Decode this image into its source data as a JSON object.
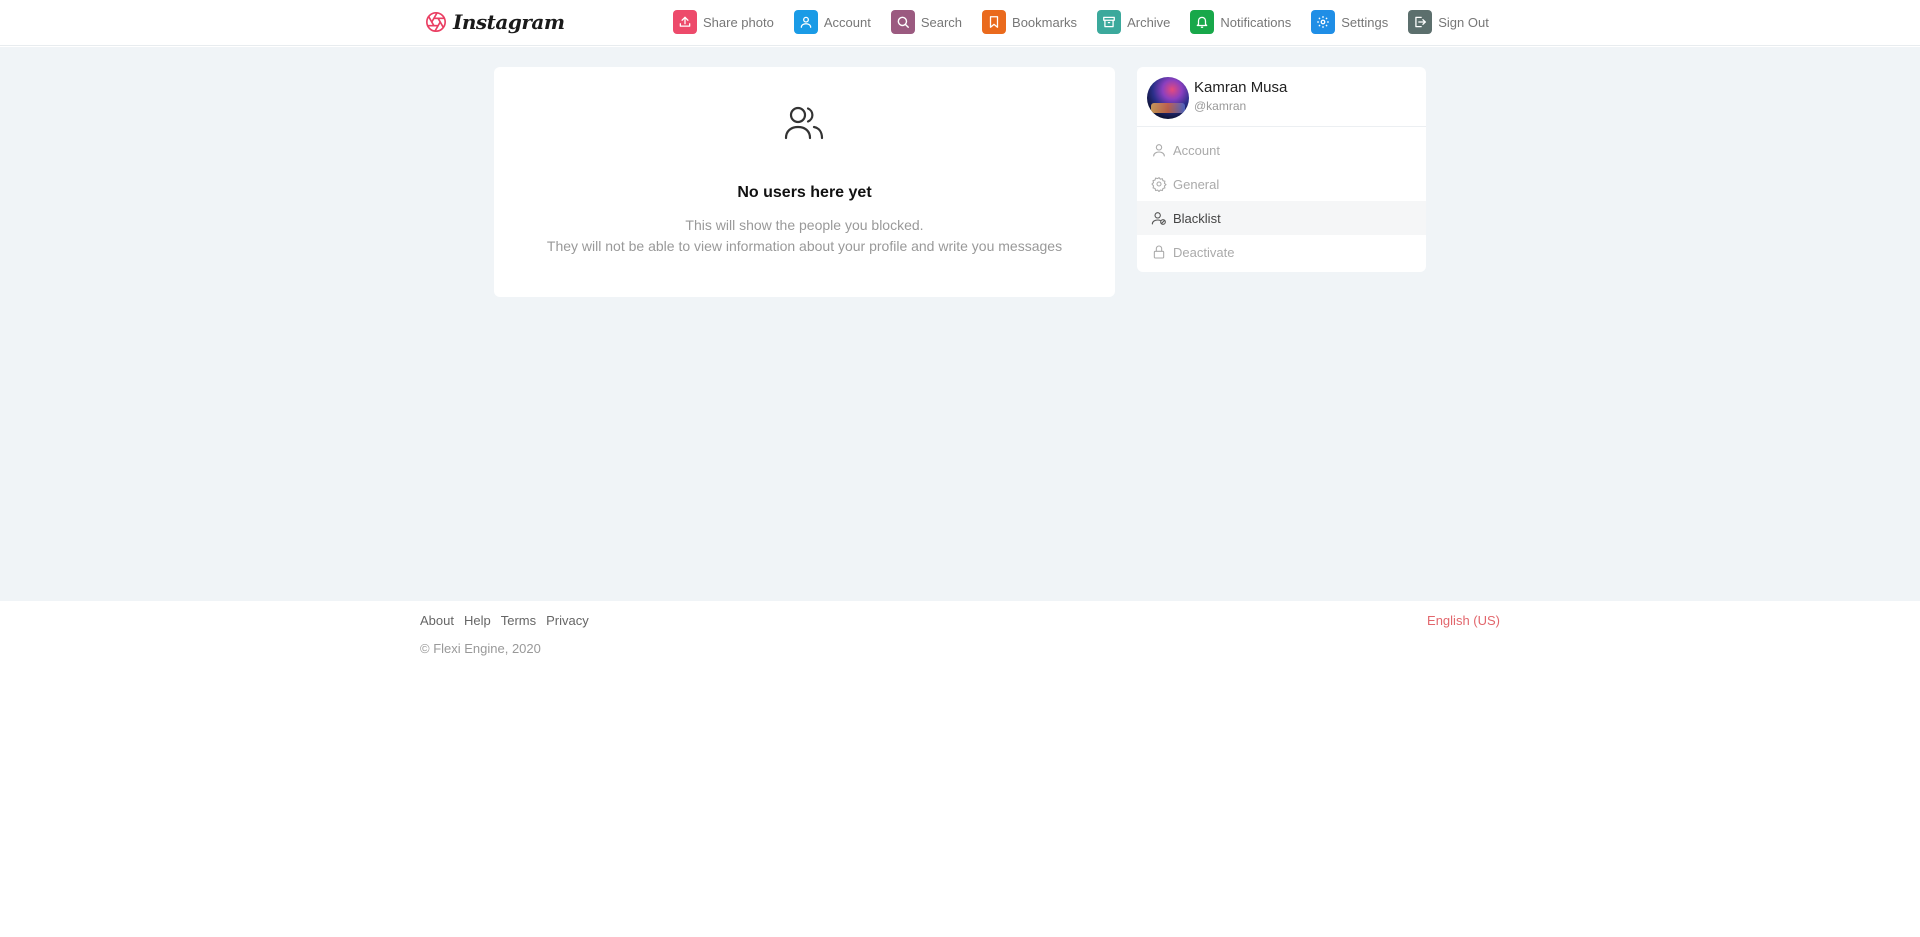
{
  "header": {
    "logo_text": "Instagram",
    "nav": [
      {
        "label": "Share photo",
        "icon": "upload-icon",
        "color": "#ed4a6b"
      },
      {
        "label": "Account",
        "icon": "user-icon",
        "color": "#1a9be6"
      },
      {
        "label": "Search",
        "icon": "search-icon",
        "color": "#9b5a80"
      },
      {
        "label": "Bookmarks",
        "icon": "bookmark-icon",
        "color": "#ea6a1d"
      },
      {
        "label": "Archive",
        "icon": "archive-icon",
        "color": "#3ba99c"
      },
      {
        "label": "Notifications",
        "icon": "bell-icon",
        "color": "#18a84a"
      },
      {
        "label": "Settings",
        "icon": "gear-icon",
        "color": "#1f8ee6"
      },
      {
        "label": "Sign Out",
        "icon": "sign-out-icon",
        "color": "#5c6f6d"
      }
    ]
  },
  "empty_state": {
    "title": "No users here yet",
    "line1": "This will show the people you blocked.",
    "line2": "They will not be able to view information about your profile and write you messages"
  },
  "profile": {
    "name": "Kamran Musa",
    "handle": "@kamran"
  },
  "menu": [
    {
      "label": "Account",
      "icon": "user-icon",
      "active": false
    },
    {
      "label": "General",
      "icon": "gear-icon",
      "active": false
    },
    {
      "label": "Blacklist",
      "icon": "user-block-icon",
      "active": true
    },
    {
      "label": "Deactivate",
      "icon": "lock-icon",
      "active": false
    }
  ],
  "footer": {
    "links": [
      "About",
      "Help",
      "Terms",
      "Privacy"
    ],
    "copyright": "© Flexi Engine, 2020",
    "language": "English (US)"
  },
  "colors": {
    "accent_link": "#e2666c",
    "background": "#f0f4f7"
  }
}
